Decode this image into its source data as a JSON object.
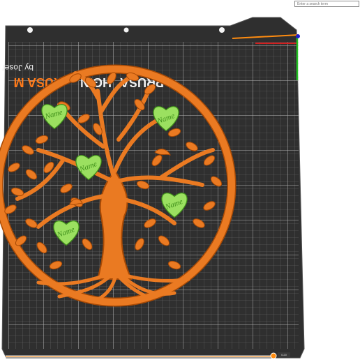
{
  "search": {
    "placeholder": "Enter a search term"
  },
  "bed": {
    "logo_text": "PRUSA",
    "logo_accent": "M",
    "logo_partial": "RUSA M",
    "author_text": "by Josef",
    "brand_fragment": "HGIN"
  },
  "model": {
    "heart_labels": [
      "Name",
      "Name",
      "Name",
      "Name",
      "Name"
    ]
  },
  "layer_slider": {
    "value_label": "0.20"
  },
  "colors": {
    "bed": "#303030",
    "grid": "#9e9e9e",
    "model": "#ea7a22",
    "model_edge": "#a84a05",
    "heart": "#9be060",
    "axis_x": "#d02020",
    "axis_y": "#22c022",
    "axis_z": "#2020d0",
    "selection": "#ff8c10"
  }
}
